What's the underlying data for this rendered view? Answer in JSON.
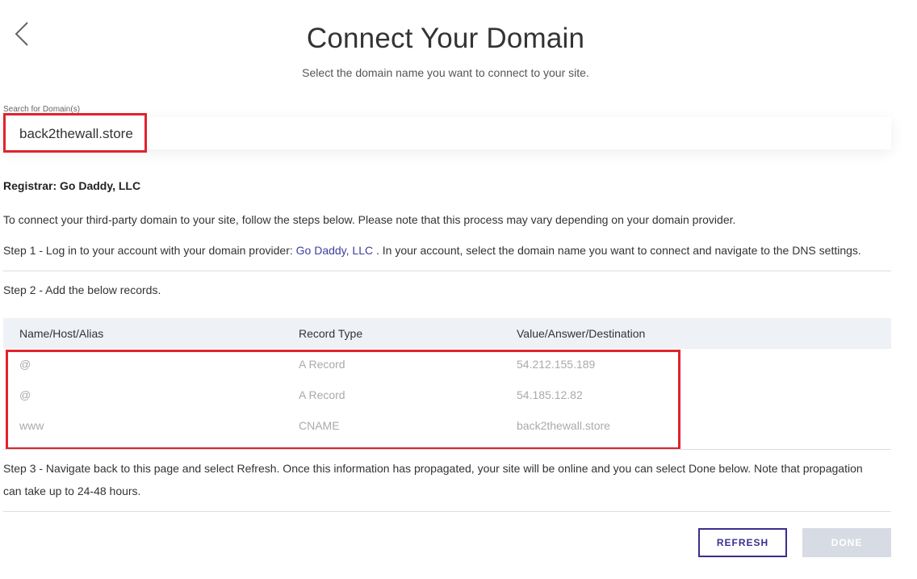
{
  "header": {
    "back_icon": "chevron-left-icon",
    "title": "Connect Your Domain",
    "subtitle": "Select the domain name you want to connect to your site."
  },
  "search": {
    "label": "Search for Domain(s)",
    "value": "back2thewall.store"
  },
  "registrar": "Registrar: Go Daddy, LLC",
  "intro": "To connect your third-party domain to your site, follow the steps below. Please note that this process may vary depending on your domain provider.",
  "step1": {
    "prefix": "Step 1 - Log in to your account with your domain provider: ",
    "link": "Go Daddy, LLC",
    "suffix": " . In your account, select the domain name you want to connect and navigate to the DNS settings."
  },
  "step2": "Step 2 - Add the below records.",
  "records": {
    "headers": [
      "Name/Host/Alias",
      "Record Type",
      "Value/Answer/Destination"
    ],
    "rows": [
      {
        "name": "@",
        "type": "A Record",
        "value": "54.212.155.189"
      },
      {
        "name": "@",
        "type": "A Record",
        "value": "54.185.12.82"
      },
      {
        "name": "www",
        "type": "CNAME",
        "value": "back2thewall.store"
      }
    ]
  },
  "step3": "Step 3 - Navigate back to this page and select Refresh. Once this information has propagated, your site will be online and you can select Done below. Note that propagation can take up to 24-48 hours.",
  "buttons": {
    "refresh": "REFRESH",
    "done": "DONE"
  },
  "colors": {
    "accent": "#3a2f8c",
    "link": "#3b3f9e",
    "highlight": "#e0232e",
    "table_header_bg": "#eef1f6",
    "done_disabled_bg": "#d7dbe4"
  }
}
